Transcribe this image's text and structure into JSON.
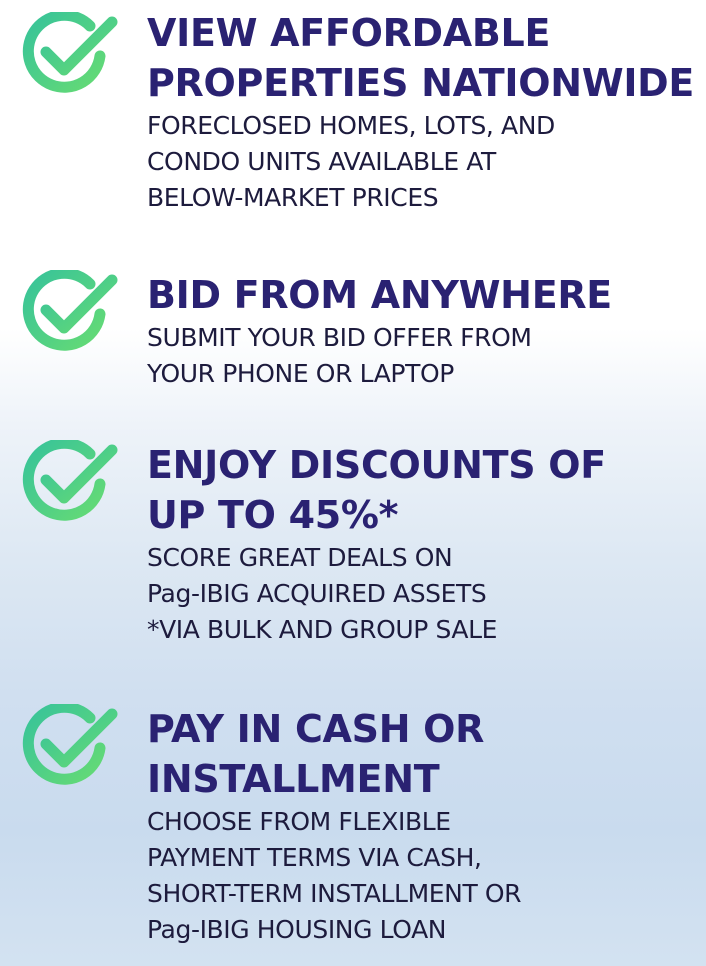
{
  "colors": {
    "title": "#2a2272",
    "text": "#1d1b3d",
    "check_start": "#3ec7a0",
    "check_end": "#5fd97a"
  },
  "icon": "check-circle-icon",
  "features": [
    {
      "title_lines": [
        "VIEW AFFORDABLE",
        "PROPERTIES NATIONWIDE"
      ],
      "desc_lines": [
        "FORECLOSED HOMES, LOTS, AND",
        "CONDO UNITS AVAILABLE AT",
        "BELOW-MARKET PRICES"
      ]
    },
    {
      "title_lines": [
        "BID FROM ANYWHERE"
      ],
      "desc_lines": [
        "SUBMIT YOUR BID OFFER FROM",
        "YOUR PHONE OR LAPTOP"
      ]
    },
    {
      "title_lines": [
        "ENJOY DISCOUNTS OF",
        "UP TO 45%*"
      ],
      "desc_lines": [
        "SCORE GREAT DEALS ON",
        "Pag-IBIG ACQUIRED ASSETS",
        "*VIA BULK AND GROUP SALE"
      ]
    },
    {
      "title_lines": [
        "PAY IN CASH OR",
        "INSTALLMENT"
      ],
      "desc_lines": [
        "CHOOSE FROM FLEXIBLE",
        "PAYMENT TERMS VIA CASH,",
        "SHORT-TERM INSTALLMENT OR",
        "Pag-IBIG HOUSING LOAN"
      ]
    }
  ]
}
